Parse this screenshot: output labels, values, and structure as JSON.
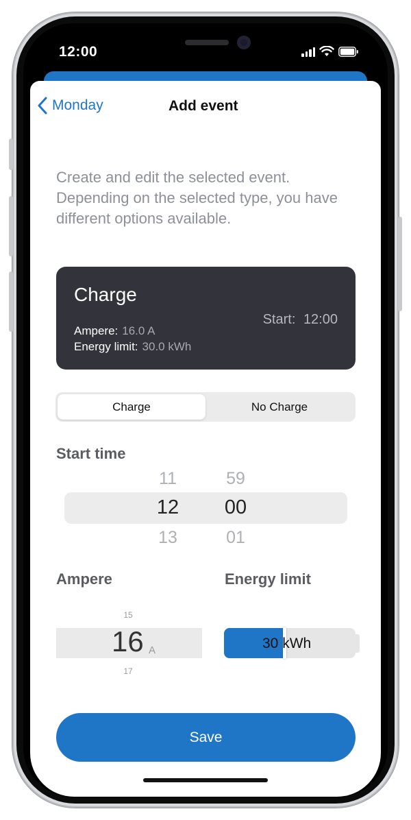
{
  "status_bar": {
    "time": "12:00"
  },
  "nav": {
    "back_label": "Monday",
    "title": "Add event"
  },
  "intro_text": "Create and edit the selected event. Depending on the selected type, you have different options available.",
  "summary_card": {
    "title": "Charge",
    "start_label": "Start:",
    "start_value": "12:00",
    "ampere_label": "Ampere:",
    "ampere_value": "16.0 A",
    "energy_label": "Energy limit:",
    "energy_value": "30.0 kWh"
  },
  "segment": {
    "options": [
      "Charge",
      "No Charge"
    ],
    "selected": "Charge"
  },
  "start_time": {
    "label": "Start time",
    "hours": {
      "prev": "11",
      "selected": "12",
      "next": "13"
    },
    "minutes": {
      "prev": "59",
      "selected": "00",
      "next": "01"
    }
  },
  "ampere": {
    "label": "Ampere",
    "prev": "15",
    "selected": "16",
    "next": "17",
    "unit": "A"
  },
  "energy_limit": {
    "label": "Energy limit",
    "value": "30",
    "unit": "kWh",
    "fill_fraction": 0.46
  },
  "save_label": "Save",
  "colors": {
    "accent": "#1f76c6",
    "card_bg": "#33333c"
  }
}
